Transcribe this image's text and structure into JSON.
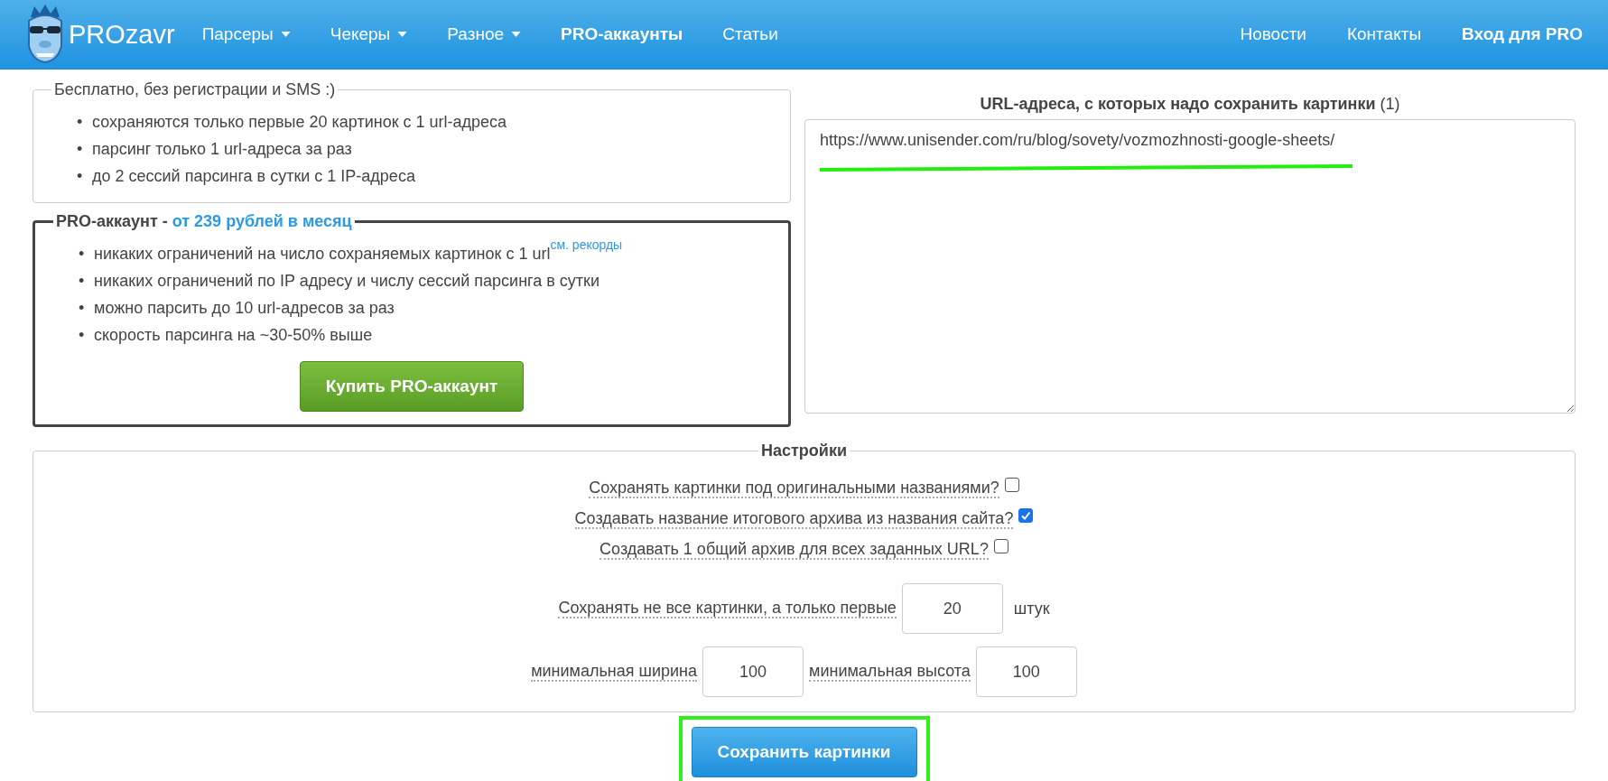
{
  "header": {
    "logo": "PROzavr",
    "nav": [
      {
        "label": "Парсеры",
        "kind": "dropdown"
      },
      {
        "label": "Чекеры",
        "kind": "dropdown"
      },
      {
        "label": "Разное",
        "kind": "dropdown"
      },
      {
        "label": "PRO-аккаунты",
        "kind": "bold"
      },
      {
        "label": "Статьи",
        "kind": "link"
      }
    ],
    "nav_right": [
      {
        "label": "Новости",
        "kind": "link"
      },
      {
        "label": "Контакты",
        "kind": "link"
      },
      {
        "label": "Вход для PRO",
        "kind": "bold"
      }
    ]
  },
  "free_box": {
    "legend": "Бесплатно, без регистрации и SMS :)",
    "bullet": "•",
    "items": [
      {
        "text": "сохраняются только первые 20 картинок с 1 url-адреса"
      },
      {
        "text": "парсинг только 1 url-адреса за раз"
      },
      {
        "text": "до 2 сессий парсинга в сутки с 1 IP-адреса"
      }
    ]
  },
  "pro_box": {
    "legend": "PRO-аккаунт - ",
    "price": "от 239 рублей в месяц",
    "bullet": "•",
    "items": [
      {
        "text": "никаких ограничений на число сохраняемых картинок с 1 url",
        "link": "см. рекорды"
      },
      {
        "text": "никаких ограничений по IP адресу и числу сессий парсинга в сутки"
      },
      {
        "text": "можно парсить до 10 url-адресов за раз"
      },
      {
        "text": "скорость парсинга на ~30-50% выше"
      }
    ],
    "button": "Купить PRO-аккаунт"
  },
  "urls": {
    "title": "**URL-адреса, с которых надо сохранить картинки** (1)",
    "value": "https://www.unisender.com/ru/blog/sovety/vozmozhnosti-google-sheets/"
  },
  "settings": {
    "legend": "Настройки",
    "checkboxes": [
      {
        "label": "Сохранять картинки под оригинальными названиями?",
        "checked": false
      },
      {
        "label": "Создавать название итогового архива из названия сайта?",
        "checked": true
      },
      {
        "label": "Создавать 1 общий архив для всех заданных URL?",
        "checked": false
      }
    ],
    "number_rows": [
      [
        {
          "label": "Сохранять не все картинки, а только первые",
          "value": "20",
          "suffix": "штук"
        }
      ],
      [
        {
          "label": "минимальная ширина",
          "value": "100"
        },
        {
          "label": "минимальная высота",
          "value": "100"
        }
      ]
    ]
  },
  "submit": "Сохранить картинки"
}
